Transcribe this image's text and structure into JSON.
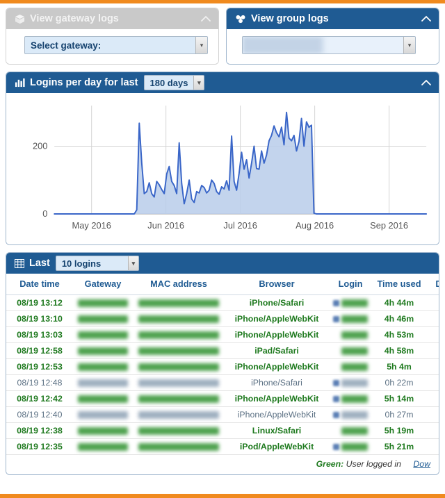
{
  "theme": {
    "accent_orange": "#f08a1e",
    "panel_blue": "#1f5b93",
    "panel_gray": "#c9c9c9",
    "green_text": "#1f7a1f",
    "gray_text": "#5c7184",
    "select_blue": "#dbeaf8",
    "chart_line": "#3a66c8",
    "chart_fill": "#b9ccea"
  },
  "gateway_panel": {
    "icon": "cube-icon",
    "title": "View gateway logs",
    "collapse_icon": "chevron-up-icon",
    "select": {
      "value": "Select gateway:",
      "arrow_icon": "chevron-down-icon"
    }
  },
  "group_panel": {
    "icon": "cubes-group-icon",
    "title": "View group logs",
    "collapse_icon": "chevron-up-icon",
    "select": {
      "value": "",
      "redacted": true,
      "arrow_icon": "chevron-down-icon"
    }
  },
  "chart_panel": {
    "icon": "bar-chart-icon",
    "title": "Logins per day for last",
    "collapse_icon": "chevron-up-icon",
    "range_select": {
      "value": "180 days",
      "arrow_icon": "chevron-down-icon"
    }
  },
  "chart_data": {
    "type": "area",
    "title": "Logins per day for last 180 days",
    "xlabel": "",
    "ylabel": "",
    "grid": true,
    "legend": false,
    "ylim": [
      0,
      320
    ],
    "yticks": [
      0,
      200
    ],
    "ytick_labels": [
      "0",
      "200"
    ],
    "xtick_labels": [
      "May 2016",
      "Jun 2016",
      "Jul 2016",
      "Aug 2016",
      "Sep 2016"
    ],
    "x_range_days": 180,
    "values": [
      0,
      0,
      0,
      0,
      0,
      0,
      0,
      0,
      0,
      0,
      0,
      0,
      0,
      0,
      0,
      0,
      0,
      0,
      0,
      0,
      0,
      0,
      0,
      0,
      0,
      0,
      0,
      0,
      0,
      0,
      0,
      0,
      0,
      12,
      268,
      150,
      60,
      66,
      92,
      60,
      50,
      96,
      86,
      72,
      60,
      118,
      140,
      96,
      84,
      60,
      210,
      90,
      30,
      60,
      100,
      44,
      34,
      66,
      62,
      84,
      78,
      62,
      70,
      100,
      90,
      66,
      58,
      80,
      74,
      98,
      70,
      230,
      96,
      70,
      120,
      182,
      132,
      160,
      106,
      150,
      200,
      134,
      132,
      186,
      150,
      174,
      216,
      232,
      260,
      240,
      228,
      256,
      204,
      300,
      224,
      216,
      232,
      186,
      214,
      282,
      200,
      272,
      256,
      262,
      2,
      0,
      0,
      0,
      0,
      0,
      0,
      0,
      0,
      0,
      0,
      0,
      0,
      0,
      0,
      0,
      0,
      0,
      0,
      0,
      0,
      0,
      0,
      0,
      0,
      0,
      0,
      0,
      0,
      0,
      0,
      0,
      0,
      0,
      0,
      0,
      0,
      0,
      0,
      0,
      0,
      0,
      0,
      0,
      0,
      0
    ]
  },
  "table_panel": {
    "icon": "table-grid-icon",
    "title": "Last",
    "count_select": {
      "value": "10 logins",
      "arrow_icon": "chevron-down-icon"
    },
    "columns": [
      "Date time",
      "Gateway",
      "MAC address",
      "Browser",
      "Login",
      "Time used",
      "D"
    ],
    "rows": [
      {
        "datetime": "08/19 13:12",
        "gateway": "",
        "mac": "",
        "browser": "iPhone/Safari",
        "login": "",
        "login_icon": true,
        "time_used": "4h 44m",
        "logged_in": true
      },
      {
        "datetime": "08/19 13:10",
        "gateway": "",
        "mac": "",
        "browser": "iPhone/AppleWebKit",
        "login": "",
        "login_icon": true,
        "time_used": "4h 46m",
        "logged_in": true
      },
      {
        "datetime": "08/19 13:03",
        "gateway": "",
        "mac": "",
        "browser": "iPhone/AppleWebKit",
        "login": "",
        "login_icon": false,
        "time_used": "4h 53m",
        "logged_in": true
      },
      {
        "datetime": "08/19 12:58",
        "gateway": "",
        "mac": "",
        "browser": "iPad/Safari",
        "login": "",
        "login_icon": false,
        "time_used": "4h 58m",
        "logged_in": true
      },
      {
        "datetime": "08/19 12:53",
        "gateway": "",
        "mac": "",
        "browser": "iPhone/AppleWebKit",
        "login": "",
        "login_icon": false,
        "time_used": "5h 4m",
        "logged_in": true
      },
      {
        "datetime": "08/19 12:48",
        "gateway": "",
        "mac": "",
        "browser": "iPhone/Safari",
        "login": "",
        "login_icon": true,
        "time_used": "0h 22m",
        "logged_in": false
      },
      {
        "datetime": "08/19 12:42",
        "gateway": "",
        "mac": "",
        "browser": "iPhone/AppleWebKit",
        "login": "",
        "login_icon": true,
        "time_used": "5h 14m",
        "logged_in": true
      },
      {
        "datetime": "08/19 12:40",
        "gateway": "",
        "mac": "",
        "browser": "iPhone/AppleWebKit",
        "login": "",
        "login_icon": true,
        "time_used": "0h 27m",
        "logged_in": false
      },
      {
        "datetime": "08/19 12:38",
        "gateway": "",
        "mac": "",
        "browser": "Linux/Safari",
        "login": "",
        "login_icon": false,
        "time_used": "5h 19m",
        "logged_in": true
      },
      {
        "datetime": "08/19 12:35",
        "gateway": "",
        "mac": "",
        "browser": "iPod/AppleWebKit",
        "login": "",
        "login_icon": true,
        "time_used": "5h 21m",
        "logged_in": true
      }
    ],
    "footer": {
      "legend_label": "Green:",
      "legend_text": "User logged in",
      "download_link": "Dow"
    }
  }
}
